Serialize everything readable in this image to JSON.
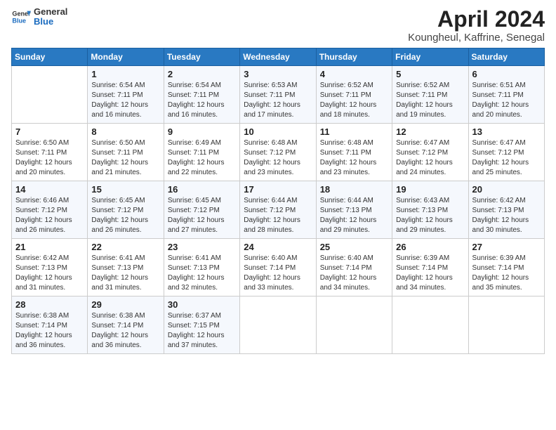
{
  "logo": {
    "line1": "General",
    "line2": "Blue"
  },
  "title": "April 2024",
  "subtitle": "Koungheul, Kaffrine, Senegal",
  "header_days": [
    "Sunday",
    "Monday",
    "Tuesday",
    "Wednesday",
    "Thursday",
    "Friday",
    "Saturday"
  ],
  "weeks": [
    [
      {
        "num": "",
        "sunrise": "",
        "sunset": "",
        "daylight": ""
      },
      {
        "num": "1",
        "sunrise": "Sunrise: 6:54 AM",
        "sunset": "Sunset: 7:11 PM",
        "daylight": "Daylight: 12 hours and 16 minutes."
      },
      {
        "num": "2",
        "sunrise": "Sunrise: 6:54 AM",
        "sunset": "Sunset: 7:11 PM",
        "daylight": "Daylight: 12 hours and 16 minutes."
      },
      {
        "num": "3",
        "sunrise": "Sunrise: 6:53 AM",
        "sunset": "Sunset: 7:11 PM",
        "daylight": "Daylight: 12 hours and 17 minutes."
      },
      {
        "num": "4",
        "sunrise": "Sunrise: 6:52 AM",
        "sunset": "Sunset: 7:11 PM",
        "daylight": "Daylight: 12 hours and 18 minutes."
      },
      {
        "num": "5",
        "sunrise": "Sunrise: 6:52 AM",
        "sunset": "Sunset: 7:11 PM",
        "daylight": "Daylight: 12 hours and 19 minutes."
      },
      {
        "num": "6",
        "sunrise": "Sunrise: 6:51 AM",
        "sunset": "Sunset: 7:11 PM",
        "daylight": "Daylight: 12 hours and 20 minutes."
      }
    ],
    [
      {
        "num": "7",
        "sunrise": "Sunrise: 6:50 AM",
        "sunset": "Sunset: 7:11 PM",
        "daylight": "Daylight: 12 hours and 20 minutes."
      },
      {
        "num": "8",
        "sunrise": "Sunrise: 6:50 AM",
        "sunset": "Sunset: 7:11 PM",
        "daylight": "Daylight: 12 hours and 21 minutes."
      },
      {
        "num": "9",
        "sunrise": "Sunrise: 6:49 AM",
        "sunset": "Sunset: 7:11 PM",
        "daylight": "Daylight: 12 hours and 22 minutes."
      },
      {
        "num": "10",
        "sunrise": "Sunrise: 6:48 AM",
        "sunset": "Sunset: 7:12 PM",
        "daylight": "Daylight: 12 hours and 23 minutes."
      },
      {
        "num": "11",
        "sunrise": "Sunrise: 6:48 AM",
        "sunset": "Sunset: 7:11 PM",
        "daylight": "Daylight: 12 hours and 23 minutes."
      },
      {
        "num": "12",
        "sunrise": "Sunrise: 6:47 AM",
        "sunset": "Sunset: 7:12 PM",
        "daylight": "Daylight: 12 hours and 24 minutes."
      },
      {
        "num": "13",
        "sunrise": "Sunrise: 6:47 AM",
        "sunset": "Sunset: 7:12 PM",
        "daylight": "Daylight: 12 hours and 25 minutes."
      }
    ],
    [
      {
        "num": "14",
        "sunrise": "Sunrise: 6:46 AM",
        "sunset": "Sunset: 7:12 PM",
        "daylight": "Daylight: 12 hours and 26 minutes."
      },
      {
        "num": "15",
        "sunrise": "Sunrise: 6:45 AM",
        "sunset": "Sunset: 7:12 PM",
        "daylight": "Daylight: 12 hours and 26 minutes."
      },
      {
        "num": "16",
        "sunrise": "Sunrise: 6:45 AM",
        "sunset": "Sunset: 7:12 PM",
        "daylight": "Daylight: 12 hours and 27 minutes."
      },
      {
        "num": "17",
        "sunrise": "Sunrise: 6:44 AM",
        "sunset": "Sunset: 7:12 PM",
        "daylight": "Daylight: 12 hours and 28 minutes."
      },
      {
        "num": "18",
        "sunrise": "Sunrise: 6:44 AM",
        "sunset": "Sunset: 7:13 PM",
        "daylight": "Daylight: 12 hours and 29 minutes."
      },
      {
        "num": "19",
        "sunrise": "Sunrise: 6:43 AM",
        "sunset": "Sunset: 7:13 PM",
        "daylight": "Daylight: 12 hours and 29 minutes."
      },
      {
        "num": "20",
        "sunrise": "Sunrise: 6:42 AM",
        "sunset": "Sunset: 7:13 PM",
        "daylight": "Daylight: 12 hours and 30 minutes."
      }
    ],
    [
      {
        "num": "21",
        "sunrise": "Sunrise: 6:42 AM",
        "sunset": "Sunset: 7:13 PM",
        "daylight": "Daylight: 12 hours and 31 minutes."
      },
      {
        "num": "22",
        "sunrise": "Sunrise: 6:41 AM",
        "sunset": "Sunset: 7:13 PM",
        "daylight": "Daylight: 12 hours and 31 minutes."
      },
      {
        "num": "23",
        "sunrise": "Sunrise: 6:41 AM",
        "sunset": "Sunset: 7:13 PM",
        "daylight": "Daylight: 12 hours and 32 minutes."
      },
      {
        "num": "24",
        "sunrise": "Sunrise: 6:40 AM",
        "sunset": "Sunset: 7:14 PM",
        "daylight": "Daylight: 12 hours and 33 minutes."
      },
      {
        "num": "25",
        "sunrise": "Sunrise: 6:40 AM",
        "sunset": "Sunset: 7:14 PM",
        "daylight": "Daylight: 12 hours and 34 minutes."
      },
      {
        "num": "26",
        "sunrise": "Sunrise: 6:39 AM",
        "sunset": "Sunset: 7:14 PM",
        "daylight": "Daylight: 12 hours and 34 minutes."
      },
      {
        "num": "27",
        "sunrise": "Sunrise: 6:39 AM",
        "sunset": "Sunset: 7:14 PM",
        "daylight": "Daylight: 12 hours and 35 minutes."
      }
    ],
    [
      {
        "num": "28",
        "sunrise": "Sunrise: 6:38 AM",
        "sunset": "Sunset: 7:14 PM",
        "daylight": "Daylight: 12 hours and 36 minutes."
      },
      {
        "num": "29",
        "sunrise": "Sunrise: 6:38 AM",
        "sunset": "Sunset: 7:14 PM",
        "daylight": "Daylight: 12 hours and 36 minutes."
      },
      {
        "num": "30",
        "sunrise": "Sunrise: 6:37 AM",
        "sunset": "Sunset: 7:15 PM",
        "daylight": "Daylight: 12 hours and 37 minutes."
      },
      {
        "num": "",
        "sunrise": "",
        "sunset": "",
        "daylight": ""
      },
      {
        "num": "",
        "sunrise": "",
        "sunset": "",
        "daylight": ""
      },
      {
        "num": "",
        "sunrise": "",
        "sunset": "",
        "daylight": ""
      },
      {
        "num": "",
        "sunrise": "",
        "sunset": "",
        "daylight": ""
      }
    ]
  ]
}
